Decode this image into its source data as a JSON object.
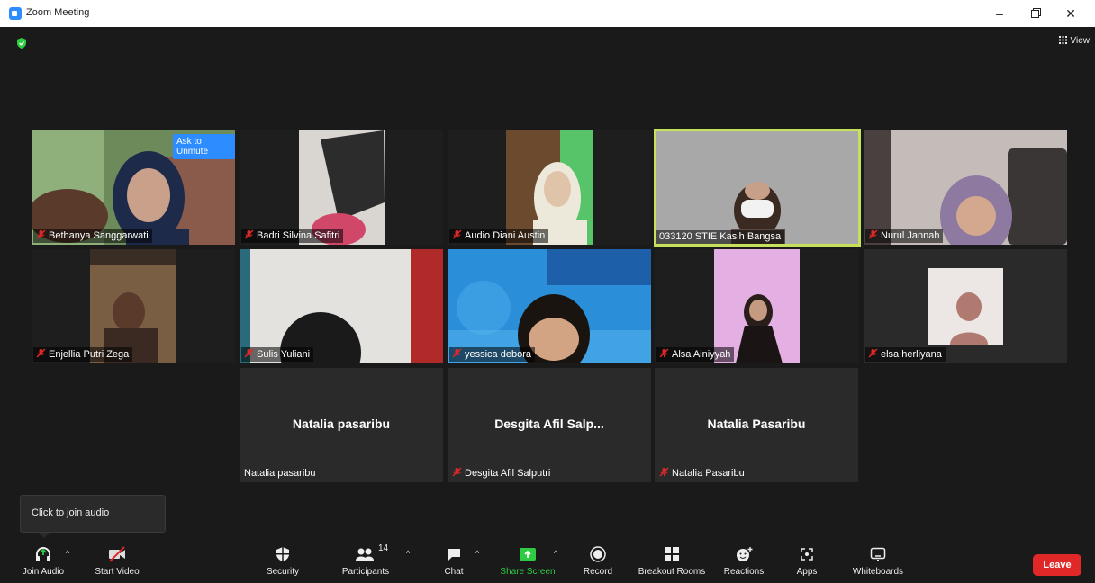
{
  "window": {
    "title": "Zoom Meeting"
  },
  "header": {
    "view_label": "View"
  },
  "tiles": [
    {
      "name": "Bethanya Sanggarwati",
      "muted": true,
      "ask_to_unmute": "Ask to Unmute",
      "more": "···"
    },
    {
      "name": "Badri Silvina Safitri",
      "muted": true
    },
    {
      "name": "Audio Diani Austin",
      "muted": true
    },
    {
      "name": "033120 STIE Kasih Bangsa",
      "muted": false,
      "active_speaker": true
    },
    {
      "name": "Nurul Jannah",
      "muted": true
    },
    {
      "name": "Enjellia Putri Zega",
      "muted": true
    },
    {
      "name": "Sulis Yuliani",
      "muted": true
    },
    {
      "name": "yessica debora",
      "muted": true
    },
    {
      "name": "Alsa Ainiyyah",
      "muted": true
    },
    {
      "name": "elsa herliyana",
      "muted": true
    },
    {
      "name": "Natalia pasaribu",
      "display_name": "Natalia pasaribu",
      "muted": false
    },
    {
      "name": "Desgita Afil Salputri",
      "display_name": "Desgita Afil Salp...",
      "muted": true
    },
    {
      "name": "Natalia Pasaribu",
      "display_name": "Natalia Pasaribu",
      "muted": true
    }
  ],
  "tooltip": {
    "text": "Click to join audio"
  },
  "toolbar": {
    "join_audio": "Join Audio",
    "start_video": "Start Video",
    "security": "Security",
    "participants": "Participants",
    "participant_count": "14",
    "chat": "Chat",
    "share_screen": "Share Screen",
    "record": "Record",
    "breakout_rooms": "Breakout Rooms",
    "reactions": "Reactions",
    "apps": "Apps",
    "whiteboards": "Whiteboards",
    "leave": "Leave"
  },
  "colors": {
    "accent": "#2d8cff",
    "share": "#2ecc40",
    "leave": "#e02828",
    "speaker_border": "#c5e05b",
    "mute_icon": "#e02828"
  }
}
